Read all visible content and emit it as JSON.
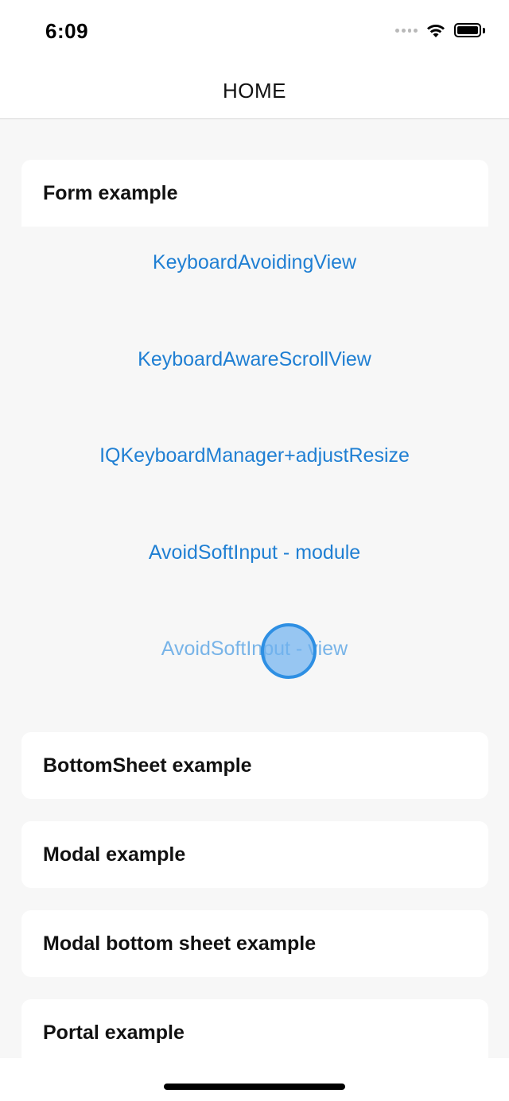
{
  "status_bar": {
    "time": "6:09",
    "icons": [
      "signal-icon",
      "wifi-icon",
      "battery-icon"
    ]
  },
  "header": {
    "title": "HOME"
  },
  "sections": {
    "form": {
      "label": "Form example",
      "links": [
        "KeyboardAvoidingView",
        "KeyboardAwareScrollView",
        "IQKeyboardManager+adjustResize",
        "AvoidSoftInput - module",
        "AvoidSoftInput - view"
      ]
    },
    "bottom_sheet": {
      "label": "BottomSheet example"
    },
    "modal": {
      "label": "Modal example"
    },
    "modal_bottom_sheet": {
      "label": "Modal bottom sheet example"
    },
    "portal": {
      "label": "Portal example"
    }
  },
  "colors": {
    "link": "#1f7fd3",
    "link_pressed": "#78b4e8",
    "background": "#f7f7f7",
    "card": "#ffffff"
  }
}
